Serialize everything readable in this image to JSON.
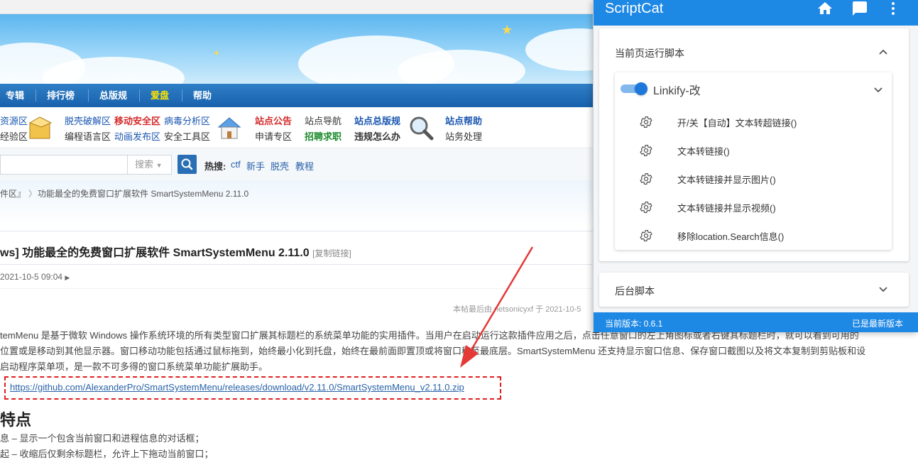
{
  "forum": {
    "nav": [
      {
        "label": "专辑",
        "color": "#ffffff"
      },
      {
        "label": "排行榜",
        "color": "#ffffff"
      },
      {
        "label": "总版规",
        "color": "#ffffff"
      },
      {
        "label": "爱盘",
        "color": "#ffe400"
      },
      {
        "label": "帮助",
        "color": "#ffffff"
      }
    ],
    "quick_links": {
      "a1": "资源区",
      "a2": "经验区",
      "b1": "脱壳破解区",
      "b2": "编程语言区",
      "c1": "移动安全区",
      "c2": "动画发布区",
      "d1": "病毒分析区",
      "d2": "安全工具区",
      "e1": "站点公告",
      "e2": "申请专区",
      "f1": "站点导航",
      "f2": "招聘求职",
      "g1": "站点总版规",
      "g2": "违规怎么办",
      "h1": "站点帮助",
      "h2": "站务处理"
    },
    "search": {
      "select_label": "搜索",
      "hot_label": "热搜:",
      "hot_terms": [
        "ctf",
        "新手",
        "脱壳",
        "教程"
      ]
    },
    "breadcrumb": {
      "prev": "件区』",
      "current": "功能最全的免费窗口扩展软件 SmartSystemMenu 2.11.0"
    },
    "post": {
      "title": "ws] 功能最全的免费窗口扩展软件 SmartSystemMenu 2.11.0",
      "copy_link": "[复制链接]",
      "time": "2021-10-5 09:04",
      "edited": "本帖最后由 netsonicyxf 于 2021-10-5",
      "body_lines": [
        "temMenu 是基于微软 Windows 操作系统环境的所有类型窗口扩展其标题栏的系统菜单功能的实用插件。当用户在启动运行这款插件应用之后，点击任意窗口的左上角图标或者右键其标题栏时，就可以看到可用的",
        "位置或是移动到其他显示器。窗口移动功能包括通过鼠标拖到，始终最小化到托盘，始终在最前面即置顶或将窗口移至最底层。SmartSystemMenu 还支持显示窗口信息、保存窗口截图以及将文本复制到剪贴板和设",
        "启动程序菜单项，是一款不可多得的窗口系统菜单功能扩展助手。"
      ],
      "download_link": "https://github.com/AlexanderPro/SmartSystemMenu/releases/download/v2.11.0/SmartSystemMenu_v2.11.0.zip",
      "features_heading": "特点",
      "features": [
        "息 – 显示一个包含当前窗口和进程信息的对话框；",
        "起 – 收缩后仅剩余标题栏，允许上下拖动当前窗口；"
      ]
    },
    "arrow_color": "#e53935"
  },
  "popup": {
    "title": "ScriptCat",
    "header_icons": [
      "home-icon",
      "chat-icon",
      "more-vert-icon"
    ],
    "section_current": {
      "title": "当前页运行脚本",
      "script": {
        "name": "Linkify-改",
        "enabled": true,
        "menu_items": [
          "开/关【自动】文本转超链接()",
          "文本转链接()",
          "文本转链接并显示图片()",
          "文本转链接并显示视频()",
          "移除location.Search信息()"
        ]
      }
    },
    "section_background": {
      "title": "后台脚本"
    },
    "footer": {
      "version": "当前版本: 0.6.1",
      "status": "已是最新版本"
    },
    "accent_color": "#1e88e5"
  }
}
